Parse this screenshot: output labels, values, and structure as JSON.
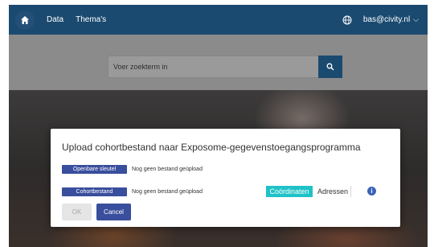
{
  "nav": {
    "home_icon": "home-icon",
    "links": [
      "Data",
      "Thema's"
    ],
    "globe_icon": "globe-icon",
    "user": "bas@civity.nl",
    "chevron_icon": "chevron-down-icon"
  },
  "search": {
    "placeholder": "Voer zoekterm in",
    "icon": "search-icon"
  },
  "modal": {
    "title": "Upload cohortbestand naar Exposome-gegevenstoegangsprogramma",
    "public_key": {
      "button": "Openbare sleutel",
      "status": "Nog geen bestand geüpload"
    },
    "cohort": {
      "button": "Cohortbestand",
      "status": "Nog geen bestand geüpload"
    },
    "toggle": {
      "active": "Coördinaten",
      "inactive": "Adressen"
    },
    "info_icon": "info-icon",
    "ok": "OK",
    "cancel": "Cancel"
  },
  "colors": {
    "nav_bg": "#1b4a70",
    "primary_button": "#394e9c",
    "toggle_active": "#1fc2c7",
    "overlay": "#8b8b8b"
  }
}
